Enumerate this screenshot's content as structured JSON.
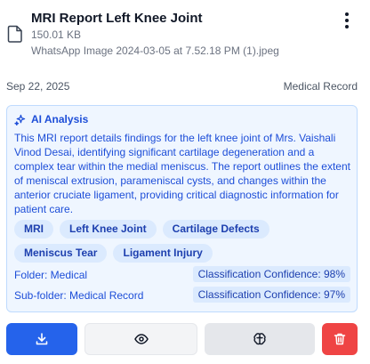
{
  "document": {
    "title": "MRI Report Left Knee Joint",
    "size": "150.01 KB",
    "filename": "WhatsApp Image 2024-03-05 at 7.52.18 PM (1).jpeg",
    "date": "Sep 22, 2025",
    "category": "Medical Record"
  },
  "ai_analysis": {
    "title": "AI Analysis",
    "summary": "This MRI report details findings for the left knee joint of Mrs. Vaishali Vinod Desai, identifying significant cartilage degeneration and a complex tear within the medial meniscus. The report outlines the extent of meniscal extrusion, parameniscal cysts, and changes within the anterior cruciate ligament, providing critical diagnostic information for patient care.",
    "tags": [
      "MRI",
      "Left Knee Joint",
      "Cartilage Defects",
      "Meniscus Tear",
      "Ligament Injury"
    ],
    "folder_label": "Folder: Medical",
    "folder_confidence": "Classification Confidence: 98%",
    "subfolder_label": "Sub-folder: Medical Record",
    "subfolder_confidence": "Classification Confidence: 97%"
  },
  "icons": {
    "file": "file-icon",
    "menu": "more-vertical-icon",
    "ai": "sparkle-icon",
    "download": "download-icon",
    "view": "eye-icon",
    "analyze": "brain-icon",
    "delete": "trash-icon"
  },
  "colors": {
    "accent": "#2563eb",
    "ai_background": "#eff6ff",
    "ai_text": "#1d4ed8",
    "danger": "#ef4444"
  }
}
